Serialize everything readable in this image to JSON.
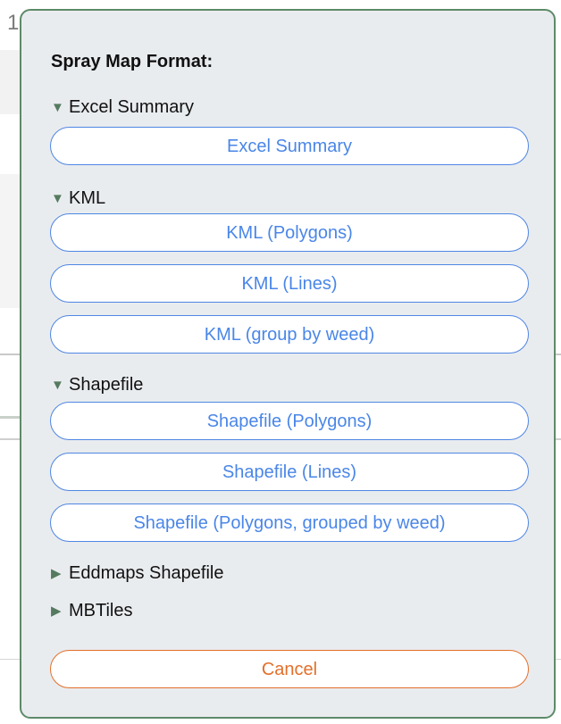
{
  "background": {
    "partial_label": "1"
  },
  "dialog": {
    "title": "Spray Map Format:",
    "sections": [
      {
        "label": "Excel Summary",
        "expanded": true,
        "options": [
          "Excel Summary"
        ]
      },
      {
        "label": "KML",
        "expanded": true,
        "options": [
          "KML (Polygons)",
          "KML (Lines)",
          "KML (group by weed)"
        ]
      },
      {
        "label": "Shapefile",
        "expanded": true,
        "options": [
          "Shapefile (Polygons)",
          "Shapefile (Lines)",
          "Shapefile (Polygons, grouped by weed)"
        ]
      },
      {
        "label": "Eddmaps Shapefile",
        "expanded": false,
        "options": []
      },
      {
        "label": "MBTiles",
        "expanded": false,
        "options": []
      }
    ],
    "cancel_label": "Cancel",
    "colors": {
      "accent_blue": "#4a86e8",
      "cancel_orange": "#e36f2a",
      "border_green": "#5d8a68",
      "triangle_green": "#557a60",
      "panel_bg": "#e9ecef"
    }
  },
  "icons": {
    "expanded": "triangle-down-icon",
    "collapsed": "triangle-right-icon"
  }
}
